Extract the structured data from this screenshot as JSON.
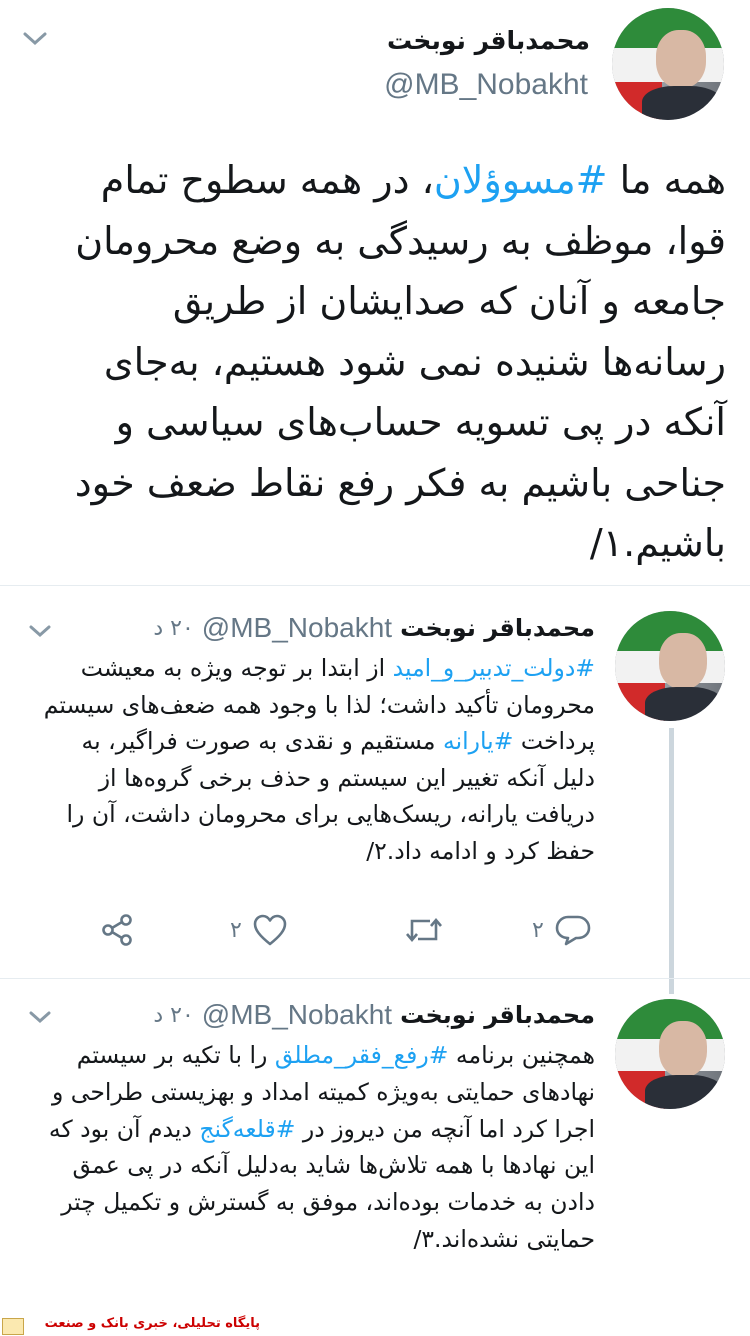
{
  "main_tweet": {
    "name": "محمدباقر نوبخت",
    "handle": "@MB_Nobakht",
    "text_before": "همه ما ",
    "hashtag": "#مسوؤلان",
    "text_after": "، در همه سطوح تمام قوا، موظف به رسیدگی به وضع محرومان جامعه و آنان که صدایشان از طریق رسانه‌ها شنیده نمی شود هستیم، به‌جای آنکه در پی تسویه حساب‌های سیاسی و جناحی باشیم به فکر رفع نقاط ضعف خود باشیم.۱/"
  },
  "reply1": {
    "name": "محمدباقر نوبخت",
    "handle": "@MB_Nobakht",
    "time": "۲۰ د",
    "hashtag1": "#دولت_تدبیر_و_امید",
    "text1": " از ابتدا بر توجه ویژه به معیشت محرومان تأکید داشت؛ لذا با وجود همه ضعف‌های سیستم پرداخت ",
    "hashtag2": "#یارانه",
    "text2": " مستقیم و نقدی به صورت فراگیر، به دلیل آنکه تغییر این سیستم و حذف برخی گروه‌ها از دریافت یارانه، ریسک‌هایی برای محرومان داشت، آن را حفظ کرد و ادامه داد.۲/",
    "reply_count": "۲",
    "like_count": "۲",
    "actions": {
      "reply_icon": "reply-icon",
      "retweet_icon": "retweet-icon",
      "like_icon": "heart-icon",
      "share_icon": "share-icon"
    }
  },
  "reply2": {
    "name": "محمدباقر نوبخت",
    "handle": "@MB_Nobakht",
    "time": "۲۰ د",
    "text1": "همچنین برنامه ",
    "hashtag1": "#رفع_فقر_مطلق",
    "text2": " را با تکیه بر سیستم نهادهای حمایتی به‌ویژه کمیته امداد و بهزیستی طراحی و اجرا کرد اما آنچه من دیروز در ",
    "hashtag2": "#قلعه‌گنج",
    "text3": " دیدم آن بود که این نهادها با همه تلاش‌ها شاید به‌دلیل آنکه در پی عمق دادن به خدمات بوده‌اند، موفق به گسترش و تکمیل چتر حمایتی نشده‌اند.۳/"
  },
  "footer": {
    "text": "پایگاه تحلیلی، خبری بانک و صنعت"
  },
  "colors": {
    "accent": "#1da1f2",
    "text": "#14171a",
    "muted": "#657786",
    "footer_text": "#cc0000"
  }
}
